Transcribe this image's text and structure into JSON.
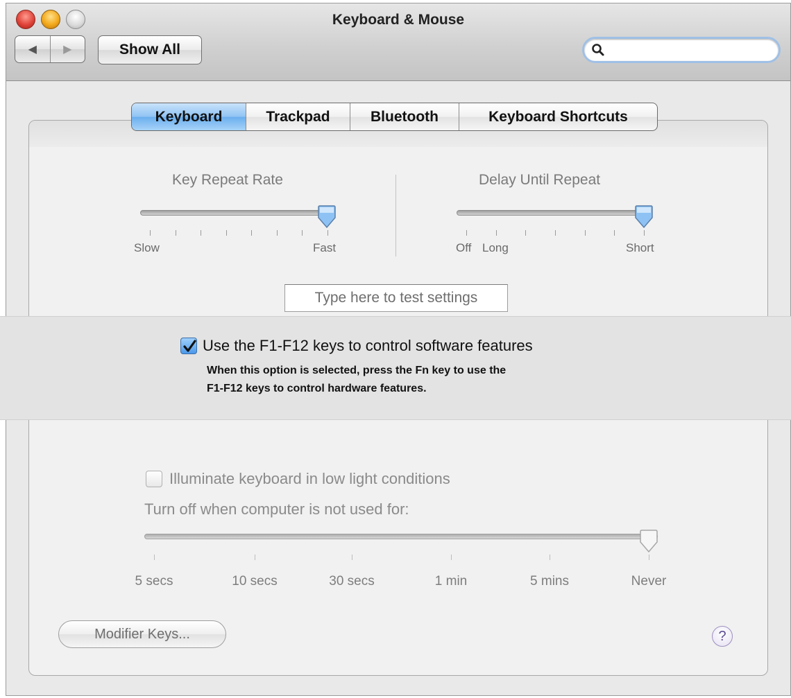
{
  "window": {
    "title": "Keyboard & Mouse"
  },
  "toolbar": {
    "back_glyph": "◀",
    "forward_glyph": "▶",
    "show_all_label": "Show All",
    "search_placeholder": ""
  },
  "tabs": [
    {
      "label": "Keyboard",
      "active": true
    },
    {
      "label": "Trackpad",
      "active": false
    },
    {
      "label": "Bluetooth",
      "active": false
    },
    {
      "label": "Keyboard Shortcuts",
      "active": false
    }
  ],
  "key_repeat": {
    "title": "Key Repeat Rate",
    "min_label": "Slow",
    "max_label": "Fast",
    "value_fraction": 1.0,
    "tick_count": 8
  },
  "delay_repeat": {
    "title": "Delay Until Repeat",
    "off_label": "Off",
    "long_label": "Long",
    "short_label": "Short",
    "value_fraction": 1.0,
    "tick_count": 7
  },
  "test_field": {
    "placeholder": "Type here to test settings"
  },
  "function_keys": {
    "checked": true,
    "label": "Use the F1-F12 keys to control software features",
    "description_line1": "When this option is selected, press the Fn key to use the",
    "description_line2": "F1-F12 keys to control hardware features."
  },
  "illumination": {
    "checked": false,
    "label": "Illuminate keyboard in low light conditions",
    "turn_off_label": "Turn off when computer is not used for:",
    "value_fraction": 1.0,
    "stops": [
      "5 secs",
      "10 secs",
      "30 secs",
      "1 min",
      "5 mins",
      "Never"
    ]
  },
  "footer": {
    "modifier_keys_label": "Modifier Keys...",
    "help_label": "?"
  },
  "colors": {
    "accent": "#6aaeee",
    "checkbox_blue": "#4b98ea"
  }
}
